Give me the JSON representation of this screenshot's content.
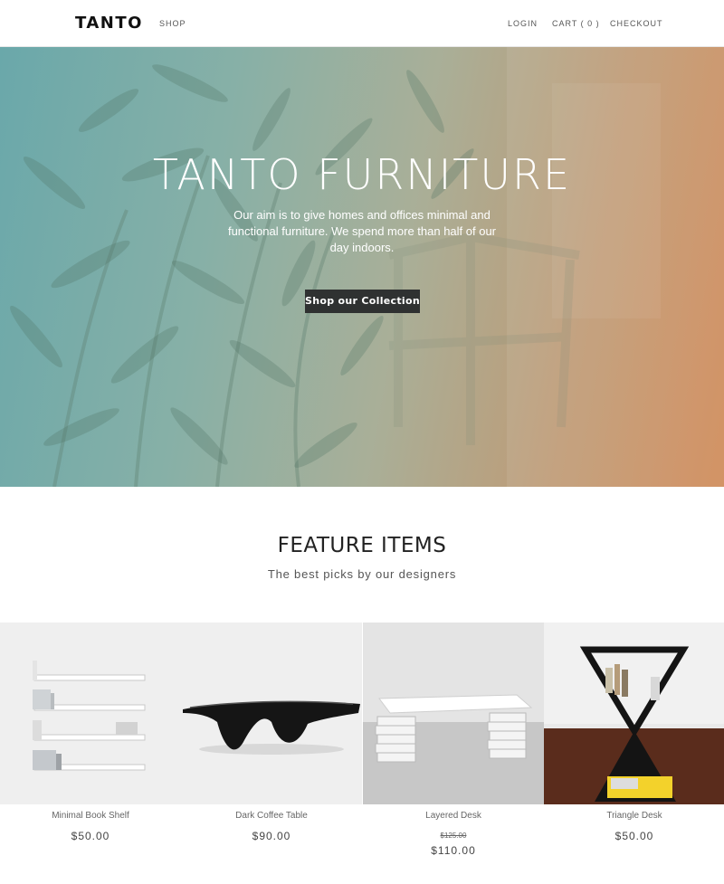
{
  "header": {
    "logo": "TANTO",
    "nav_left": [
      "SHOP"
    ],
    "login": "LOGIN",
    "cart": "CART ( 0 )",
    "checkout": "CHECKOUT"
  },
  "hero": {
    "title": "TANTO FURNITURE",
    "subtitle": "Our aim is to give homes and offices minimal and functional furniture. We spend more than half of our day indoors.",
    "button": "Shop our Collection"
  },
  "features": {
    "title": "FEATURE ITEMS",
    "subtitle": "The best picks by our designers",
    "products": [
      {
        "name": "Minimal Book Shelf",
        "price": "$50.00"
      },
      {
        "name": "Dark Coffee Table",
        "price": "$90.00"
      },
      {
        "name": "Layered Desk",
        "old_price": "$125.00",
        "price": "$110.00"
      },
      {
        "name": "Triangle Desk",
        "price": "$50.00"
      }
    ]
  }
}
